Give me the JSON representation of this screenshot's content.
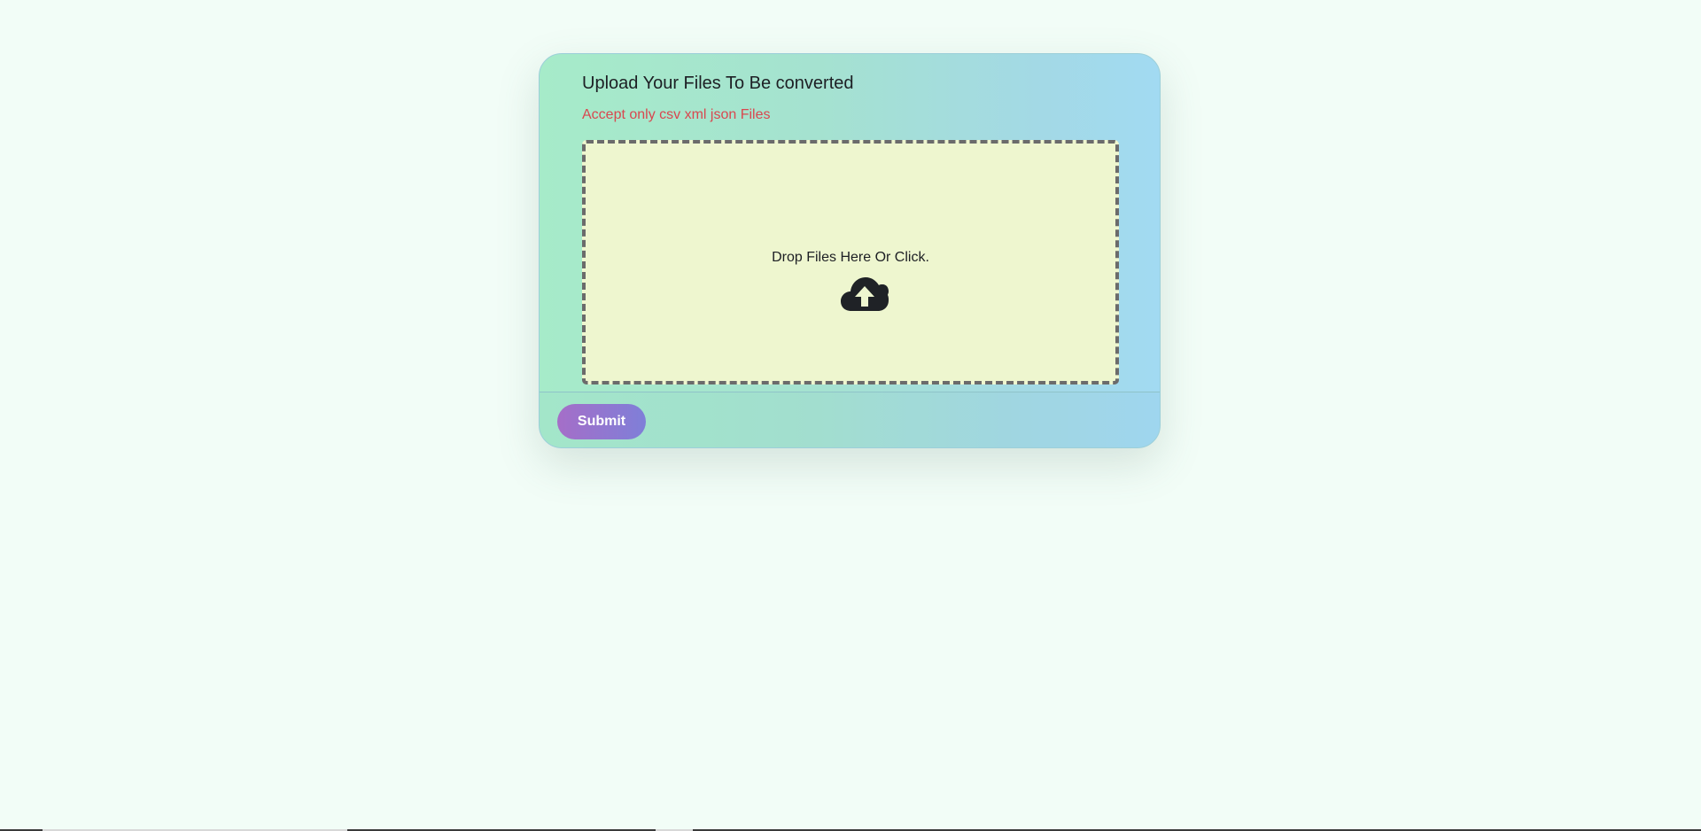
{
  "upload_card": {
    "title": "Upload Your Files To Be converted",
    "subtitle": "Accept only csv xml json Files",
    "dropzone": {
      "text": "Drop Files Here Or Click.",
      "icon": "cloud-upload-icon"
    },
    "submit_label": "Submit"
  },
  "colors": {
    "page_background": "#f2fdf7",
    "card_gradient_start": "#a6ebc9",
    "card_gradient_end": "#a2daf2",
    "dropzone_background": "#eef6cf",
    "subtitle_color": "#d9474f",
    "submit_gradient_start": "#a56ec8",
    "submit_gradient_end": "#7f7fd8"
  }
}
